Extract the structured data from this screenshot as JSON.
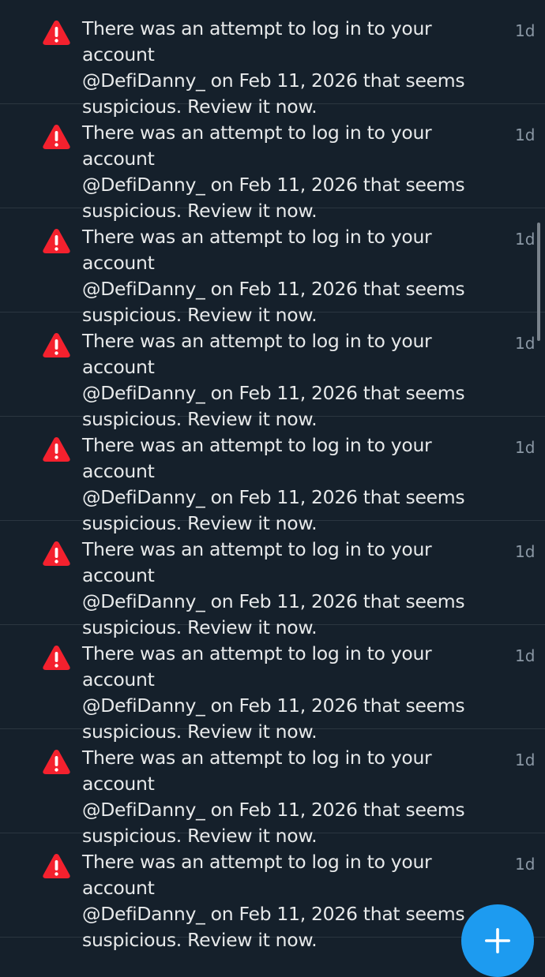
{
  "notifications": [
    {
      "icon": "warning-icon",
      "text": "There was an attempt to log in to your account\n@DefiDanny_ on Feb 11, 2026 that seems\nsuspicious. Review it now.",
      "time": "1d"
    },
    {
      "icon": "warning-icon",
      "text": "There was an attempt to log in to your account\n@DefiDanny_ on Feb 11, 2026 that seems\nsuspicious. Review it now.",
      "time": "1d"
    },
    {
      "icon": "warning-icon",
      "text": "There was an attempt to log in to your account\n@DefiDanny_ on Feb 11, 2026 that seems\nsuspicious. Review it now.",
      "time": "1d"
    },
    {
      "icon": "warning-icon",
      "text": "There was an attempt to log in to your account\n@DefiDanny_ on Feb 11, 2026 that seems\nsuspicious. Review it now.",
      "time": "1d"
    },
    {
      "icon": "warning-icon",
      "text": "There was an attempt to log in to your account\n@DefiDanny_ on Feb 11, 2026 that seems\nsuspicious. Review it now.",
      "time": "1d"
    },
    {
      "icon": "warning-icon",
      "text": "There was an attempt to log in to your account\n@DefiDanny_ on Feb 11, 2026 that seems\nsuspicious. Review it now.",
      "time": "1d"
    },
    {
      "icon": "warning-icon",
      "text": "There was an attempt to log in to your account\n@DefiDanny_ on Feb 11, 2026 that seems\nsuspicious. Review it now.",
      "time": "1d"
    },
    {
      "icon": "warning-icon",
      "text": "There was an attempt to log in to your account\n@DefiDanny_ on Feb 11, 2026 that seems\nsuspicious. Review it now.",
      "time": "1d"
    },
    {
      "icon": "warning-icon",
      "text": "There was an attempt to log in to your account\n@DefiDanny_ on Feb 11, 2026 that seems\nsuspicious. Review it now.",
      "time": "1d"
    }
  ],
  "compose_button": {
    "icon": "plus-icon"
  },
  "colors": {
    "background": "#15202b",
    "text": "#e7e9ea",
    "muted": "#8b98a5",
    "divider": "#2b3640",
    "warning": "#f4212e",
    "accent": "#1d9bf0"
  }
}
